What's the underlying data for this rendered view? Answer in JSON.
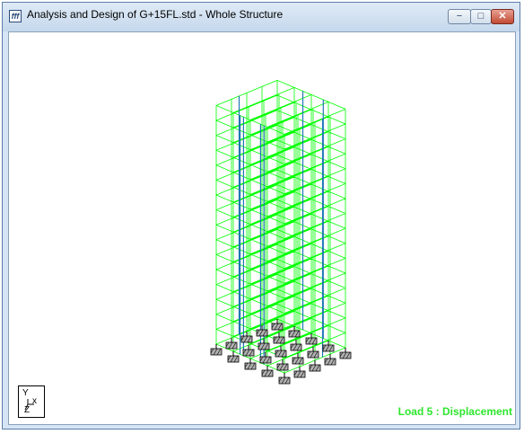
{
  "window": {
    "title": "Analysis and Design of G+15FL.std - Whole Structure",
    "icon": "staad-doc-icon",
    "controls": {
      "minimize_glyph": "−",
      "maximize_glyph": "□",
      "close_glyph": "✕"
    }
  },
  "viewport": {
    "status_text": "Load 5 : Displacement",
    "status_color": "#2ee62e",
    "frame_color": "#00ff00",
    "core_wall_color": "#1f77b4",
    "support_fill": "#b0b0b0",
    "axis_triad": {
      "y": "Y",
      "x": "x",
      "z": "Z"
    }
  }
}
